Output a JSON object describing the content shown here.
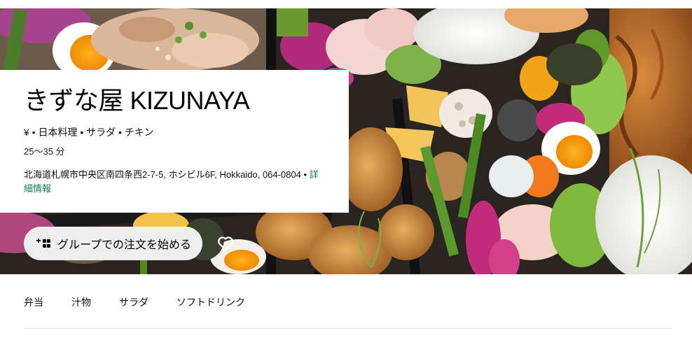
{
  "store": {
    "name": "きずな屋 KIZUNAYA",
    "meta": "¥ • 日本料理 • サラダ • チキン",
    "eta": "25〜35 分",
    "address": "北海道札幌市中央区南四条西2-7-5, ホシビル6F, Hokkaido, 064-0804",
    "address_separator": " • ",
    "details_link": "詳細情報"
  },
  "actions": {
    "group_order_label": "グループでの注文を始める",
    "group_order_icon": "group-add-icon",
    "favorite_icon": "heart-outline-icon"
  },
  "hero": {
    "image_subject": "bento-boxes-photo"
  },
  "tabs": [
    {
      "label": "弁当"
    },
    {
      "label": "汁物"
    },
    {
      "label": "サラダ"
    },
    {
      "label": "ソフトドリンク"
    }
  ],
  "colors": {
    "link": "#0e8345",
    "button_bg": "#eeeeee",
    "divider": "#e4e4e4"
  }
}
